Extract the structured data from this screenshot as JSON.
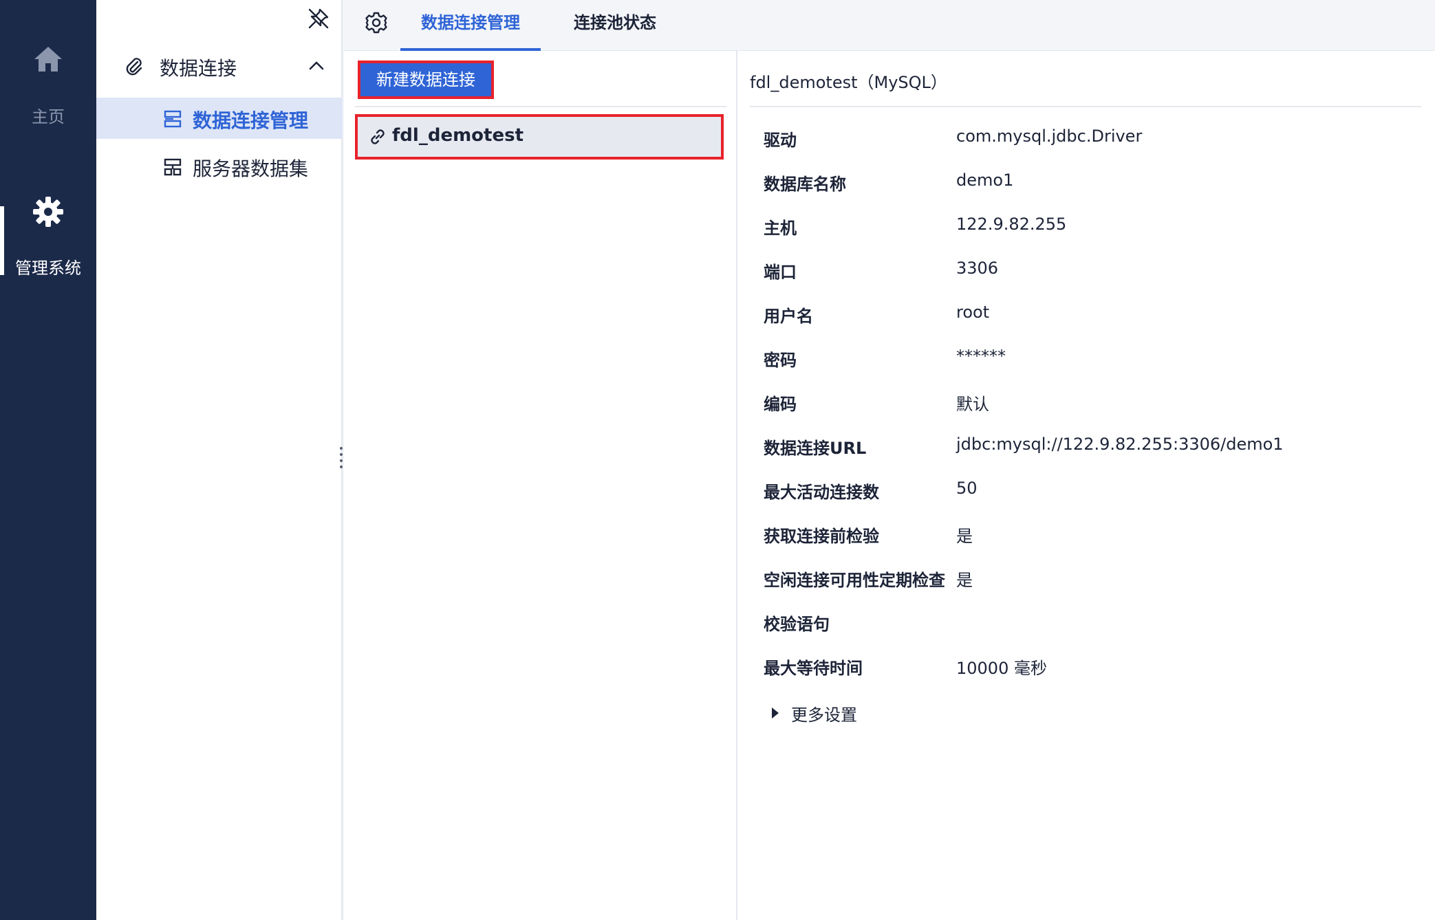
{
  "rail": {
    "home_label": "主页",
    "admin_label": "管理系统"
  },
  "subnav": {
    "group_label": "数据连接",
    "items": [
      {
        "label": "数据连接管理",
        "active": true
      },
      {
        "label": "服务器数据集",
        "active": false
      }
    ]
  },
  "tabs": [
    {
      "label": "数据连接管理",
      "active": true
    },
    {
      "label": "连接池状态",
      "active": false
    }
  ],
  "list": {
    "new_button_label": "新建数据连接",
    "connections": [
      {
        "name": "fdl_demotest",
        "selected": true
      }
    ]
  },
  "detail": {
    "title": "fdl_demotest（MySQL）",
    "properties": [
      {
        "label": "驱动",
        "value": "com.mysql.jdbc.Driver"
      },
      {
        "label": "数据库名称",
        "value": "demo1"
      },
      {
        "label": "主机",
        "value": "122.9.82.255"
      },
      {
        "label": "端口",
        "value": "3306"
      },
      {
        "label": "用户名",
        "value": "root"
      },
      {
        "label": "密码",
        "value": "******"
      },
      {
        "label": "编码",
        "value": "默认"
      },
      {
        "label": "数据连接URL",
        "value": "jdbc:mysql://122.9.82.255:3306/demo1"
      },
      {
        "label": "最大活动连接数",
        "value": "50"
      },
      {
        "label": "获取连接前检验",
        "value": "是"
      },
      {
        "label": "空闲连接可用性定期检查",
        "value": "是"
      },
      {
        "label": "校验语句",
        "value": ""
      },
      {
        "label": "最大等待时间",
        "value": "10000 毫秒"
      }
    ],
    "more_settings_label": "更多设置"
  },
  "colors": {
    "rail_bg": "#1c2a4a",
    "accent": "#2f64d6",
    "highlight_border": "#e8222b",
    "active_nav_bg": "#dde5f7"
  },
  "icons": {
    "home": "home-icon",
    "admin": "gear-icon",
    "pin": "unpin-icon",
    "group": "paperclip-icon",
    "chevron": "chevron-up-icon",
    "nav_item": "data-connection-icon",
    "nav_item_2": "server-dataset-icon",
    "tab_settings": "gear-icon",
    "connection": "link-icon",
    "expand": "caret-right-icon"
  }
}
